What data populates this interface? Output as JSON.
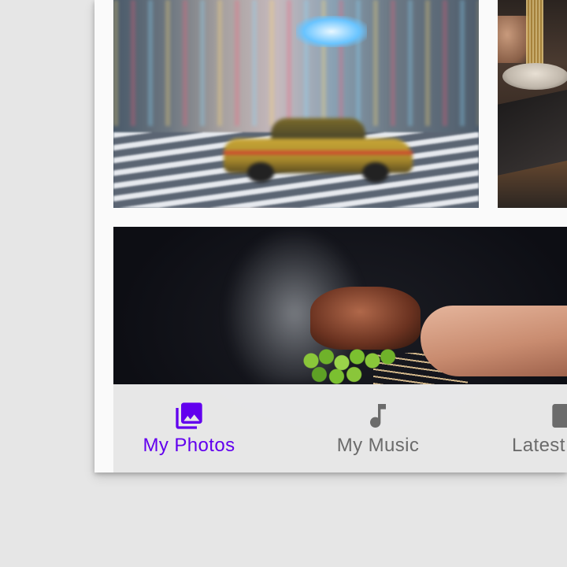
{
  "colors": {
    "accent": "#6200ee",
    "inactive": "#6b6b6b",
    "background": "#fafafa",
    "outside": "#e6e6e6"
  },
  "gallery": {
    "photos": [
      {
        "subject": "taxi-street"
      },
      {
        "subject": "ramen"
      },
      {
        "subject": "skewers-grill"
      }
    ]
  },
  "bottom_nav": {
    "items": [
      {
        "label": "My Photos",
        "icon": "photo-library-icon",
        "selected": true
      },
      {
        "label": "My Music",
        "icon": "music-note-icon",
        "selected": false
      },
      {
        "label": "Latest",
        "icon": "latest-icon",
        "selected": false
      }
    ]
  }
}
